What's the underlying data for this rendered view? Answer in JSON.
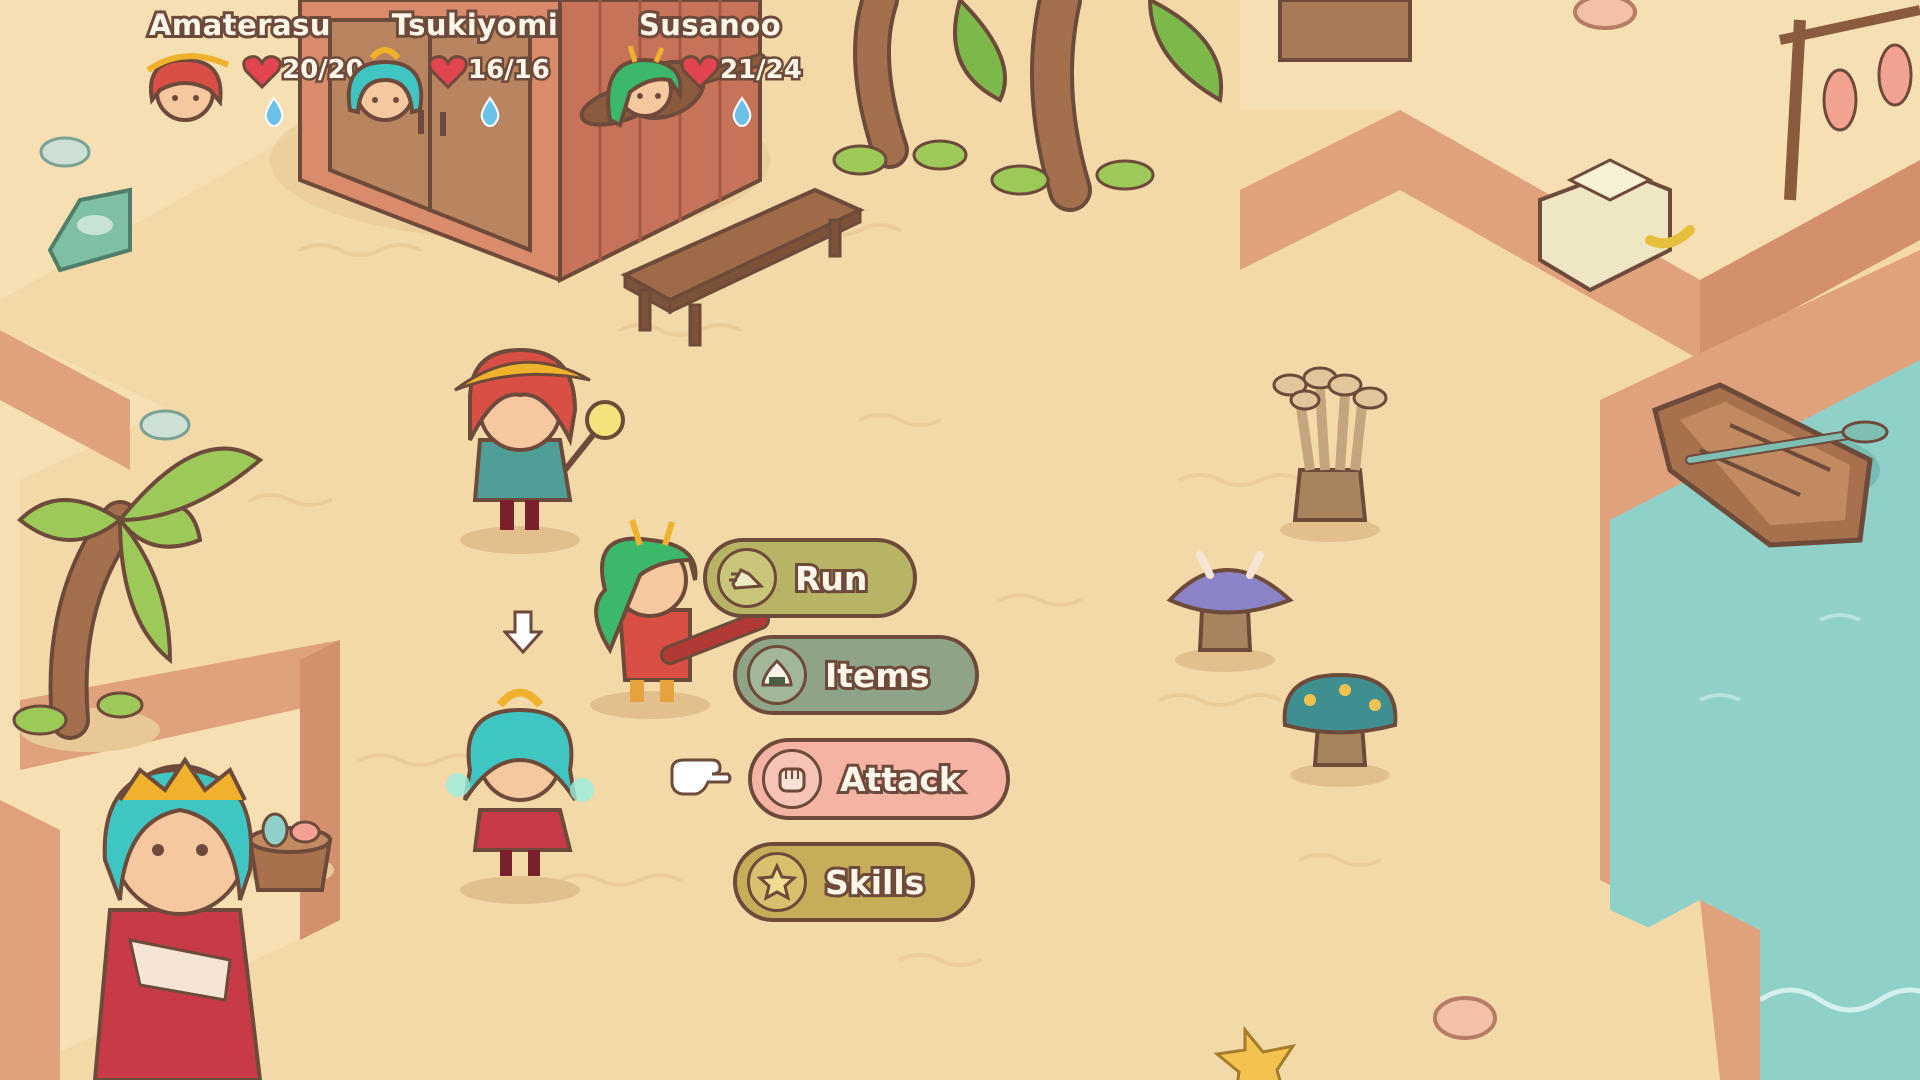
{
  "party": [
    {
      "name": "Amaterasu",
      "hp": "20/20",
      "portrait": "amaterasu-portrait",
      "accent": "#d9574a"
    },
    {
      "name": "Tsukiyomi",
      "hp": "16/16",
      "portrait": "tsukiyomi-portrait",
      "accent": "#3fc6c2"
    },
    {
      "name": "Susanoo",
      "hp": "21/24",
      "portrait": "susanoo-portrait",
      "accent": "#3cb86a"
    }
  ],
  "commands": {
    "run": {
      "label": "Run",
      "icon": "running-shoe-icon"
    },
    "items": {
      "label": "Items",
      "icon": "onigiri-icon"
    },
    "attack": {
      "label": "Attack",
      "icon": "fist-icon",
      "selected": true
    },
    "skills": {
      "label": "Skills",
      "icon": "star-icon"
    }
  },
  "colors": {
    "sand": "#f3d9a8",
    "cliff": "#e0a27c",
    "water": "#8fd0c8",
    "outline": "#6e4a3a",
    "heart": "#e2454f",
    "mana": "#6cc2e6"
  },
  "icons": [
    "heart-icon",
    "water-drop-icon",
    "pointing-hand-icon",
    "down-arrow-icon"
  ]
}
